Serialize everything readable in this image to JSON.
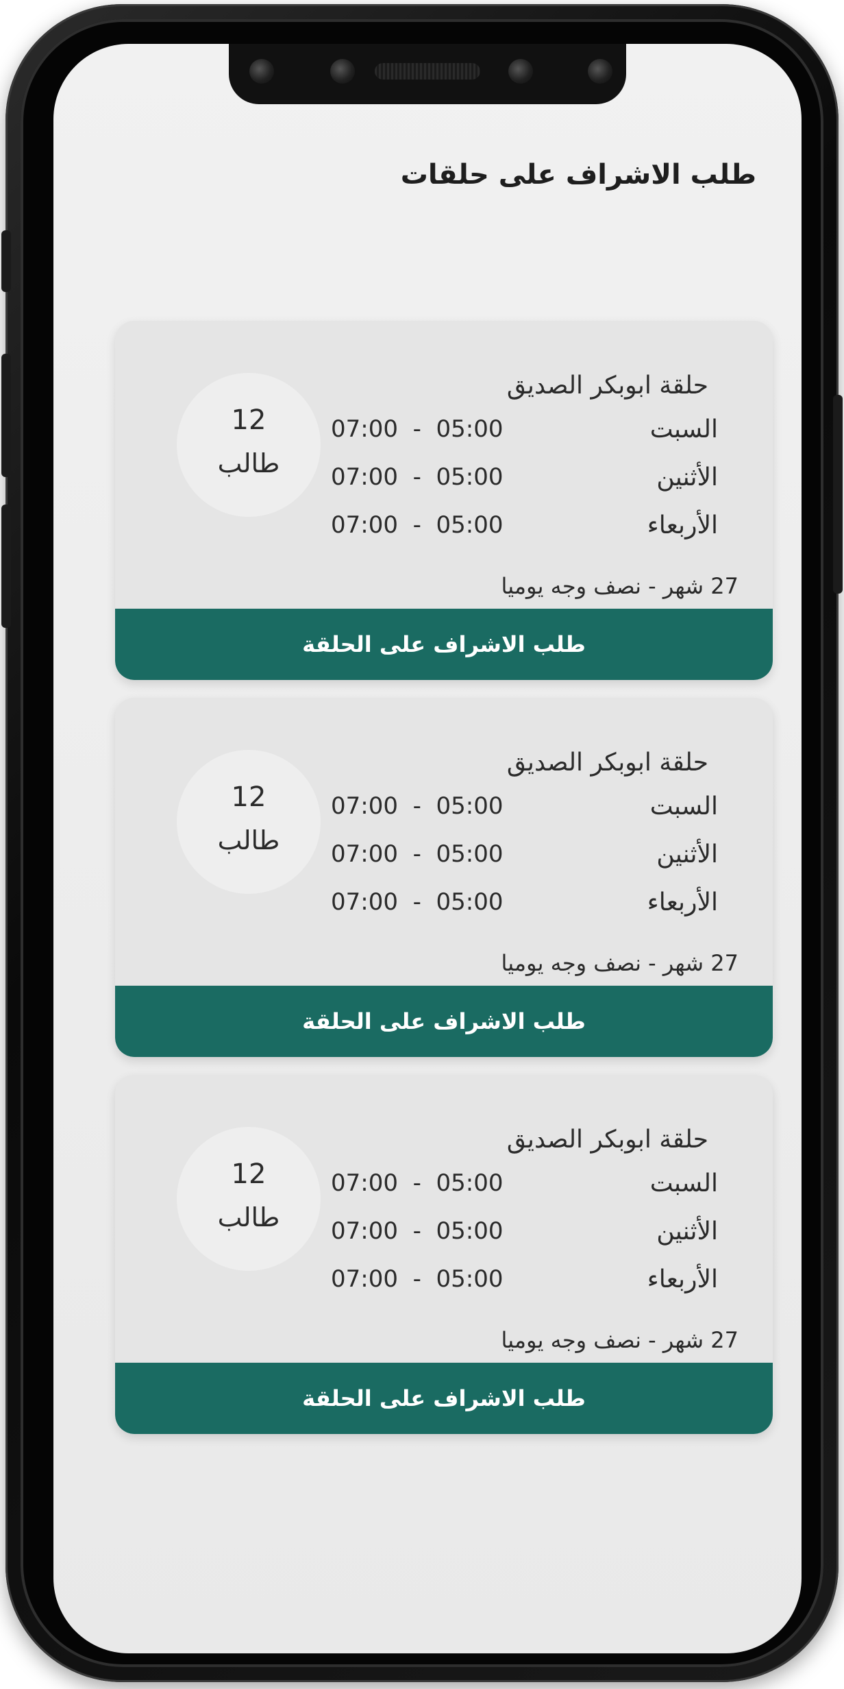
{
  "page": {
    "title": "طلب الاشراف على حلقات"
  },
  "colors": {
    "accent": "#1a6b62",
    "card_bg": "#e5e5e5",
    "screen_bg": "#ededed"
  },
  "cards": [
    {
      "name": "حلقة  ابوبكر الصديق",
      "schedule": [
        {
          "day": "السبت",
          "time": "07:00  -  05:00"
        },
        {
          "day": "الأثنين",
          "time": "07:00  -  05:00"
        },
        {
          "day": "الأربعاء",
          "time": "07:00  -  05:00"
        }
      ],
      "note": "27   شهر - نصف وجه يوميا",
      "students_count": "12",
      "students_unit": "طالب",
      "button_label": "طلب الاشراف على الحلقة"
    },
    {
      "name": "حلقة  ابوبكر الصديق",
      "schedule": [
        {
          "day": "السبت",
          "time": "07:00  -  05:00"
        },
        {
          "day": "الأثنين",
          "time": "07:00  -  05:00"
        },
        {
          "day": "الأربعاء",
          "time": "07:00  -  05:00"
        }
      ],
      "note": "27   شهر - نصف وجه يوميا",
      "students_count": "12",
      "students_unit": "طالب",
      "button_label": "طلب الاشراف على الحلقة"
    },
    {
      "name": "حلقة  ابوبكر الصديق",
      "schedule": [
        {
          "day": "السبت",
          "time": "07:00  -  05:00"
        },
        {
          "day": "الأثنين",
          "time": "07:00  -  05:00"
        },
        {
          "day": "الأربعاء",
          "time": "07:00  -  05:00"
        }
      ],
      "note": "27   شهر - نصف وجه يوميا",
      "students_count": "12",
      "students_unit": "طالب",
      "button_label": "طلب الاشراف على الحلقة"
    }
  ]
}
